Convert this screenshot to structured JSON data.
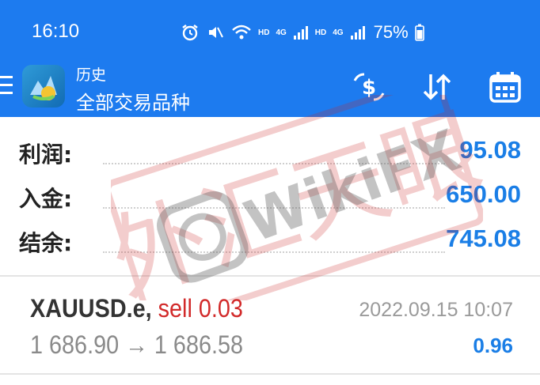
{
  "status_bar": {
    "time": "16:10",
    "hd_1": "HD",
    "net_1": "4G",
    "hd_2": "HD",
    "net_2": "4G",
    "battery": "75%"
  },
  "app_bar": {
    "subtitle": "历史",
    "title": "全部交易品种",
    "icons": [
      "menu-icon",
      "app-logo",
      "currency-exchange-icon",
      "sort-icon",
      "calendar-icon"
    ]
  },
  "summary": [
    {
      "label": "利润:",
      "value": "95.08"
    },
    {
      "label": "入金:",
      "value": "650.00"
    },
    {
      "label": "结余:",
      "value": "745.08"
    }
  ],
  "deals": [
    {
      "symbol": "XAUUSD.e,",
      "trade": "sell 0.03",
      "time": "2022.09.15 10:07",
      "prices": "1 686.90 → 1 686.58",
      "profit": "0.96"
    }
  ],
  "watermark": {
    "text": "WikiFX",
    "stamp_text": "外汇天眼"
  },
  "colors": {
    "header": "#1d7bef",
    "value_blue": "#1a7ee6",
    "sell_red": "#d22a2a"
  }
}
